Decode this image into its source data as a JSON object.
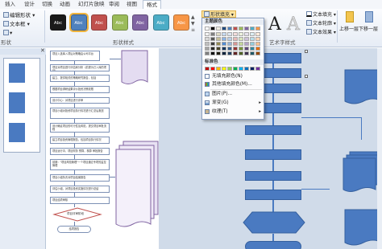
{
  "tabs": [
    "插入",
    "设计",
    "切换",
    "动画",
    "幻灯片放映",
    "审阅",
    "视图",
    "格式"
  ],
  "active_tab": "格式",
  "ribbon": {
    "edit_shape": "编辑形状",
    "textbox": "文本框",
    "group_shape_left": "形状",
    "group_shape_styles": "形状样式",
    "group_wordart": "艺术字样式",
    "shape_fill": "形状填充",
    "text_fill": "文本填充",
    "text_outline": "文本轮廓",
    "text_effect": "文本效果",
    "bring_forward": "上移一层",
    "send_backward": "下移一层",
    "swatch_text": "Abc"
  },
  "shape_styles": [
    {
      "label": "Abc",
      "color": "#1a1a1a"
    },
    {
      "label": "Abc",
      "color": "#4f81bd"
    },
    {
      "label": "Abc",
      "color": "#c0504d"
    },
    {
      "label": "Abc",
      "color": "#9bbb59"
    },
    {
      "label": "Abc",
      "color": "#8064a2"
    },
    {
      "label": "Abc",
      "color": "#4bacc6"
    },
    {
      "label": "Abc",
      "color": "#f79646"
    }
  ],
  "wordart": [
    {
      "label": "A",
      "color": "#1f1f1f"
    },
    {
      "label": "A",
      "color": "#d9d9d9"
    }
  ],
  "menu": {
    "theme_colors": "主题颜色",
    "standard_colors": "标准色",
    "no_fill": "无填充颜色(N)",
    "more_fill": "其他填充颜色(M)...",
    "picture": "图片(P)...",
    "gradient": "渐变(G)",
    "texture": "纹理(T)",
    "theme_rows": [
      [
        "#ffffff",
        "#000000",
        "#eeece1",
        "#1f497d",
        "#4f81bd",
        "#c0504d",
        "#9bbb59",
        "#8064a2",
        "#4bacc6",
        "#f79646"
      ],
      [
        "#f2f2f2",
        "#7f7f7f",
        "#ddd9c3",
        "#c6d9f0",
        "#dbe5f1",
        "#f2dcdb",
        "#ebf1dd",
        "#e5e0ec",
        "#dbeef3",
        "#fdeada"
      ],
      [
        "#d8d8d8",
        "#595959",
        "#c4bd97",
        "#8db3e2",
        "#b8cce4",
        "#e5b9b7",
        "#d7e3bc",
        "#ccc1d9",
        "#b7dde8",
        "#fbd5b5"
      ],
      [
        "#bfbfbf",
        "#3f3f3f",
        "#938953",
        "#548dd4",
        "#95b3d7",
        "#d99694",
        "#c3d69b",
        "#b2a2c7",
        "#92cddc",
        "#fac08f"
      ],
      [
        "#a5a5a5",
        "#262626",
        "#494429",
        "#17365d",
        "#366092",
        "#953734",
        "#76923c",
        "#5f497a",
        "#31859b",
        "#e36c09"
      ],
      [
        "#7f7f7f",
        "#0c0c0c",
        "#1d1b10",
        "#0f243e",
        "#244061",
        "#632423",
        "#4f6128",
        "#3f3151",
        "#205867",
        "#974806"
      ]
    ],
    "standard_row": [
      "#c00000",
      "#ff0000",
      "#ffc000",
      "#ffff00",
      "#92d050",
      "#00b050",
      "#00b0f0",
      "#0070c0",
      "#002060",
      "#7030a0"
    ]
  },
  "slide_text": [
    "项目入选库入项后对策略由公司平台",
    "项目对项目进行评估和分析（前提为已入库的项目）",
    "建立、提供相关的策略研究报告，包括",
    "根据项目调研结果评价投资决策权限",
    "设计中心：对项目进行评审",
    "项目小组对投资项目执行情况进行汇总后报送",
    "设计确定项目的可行性及风险，提交项目审批流程",
    "建立项目投资管理报告，包括项目执行情况",
    "项目运行中，项目财务 预算，核算 审批报告",
    "前期：\"项目风险管理\"一个项目通过专项的监控管理",
    "项目小组负责对项目结案报告",
    "评估小组，对项目投资实施情况进行总结",
    "项目结项审核",
    "项目评审阶段",
    "结项报告"
  ]
}
